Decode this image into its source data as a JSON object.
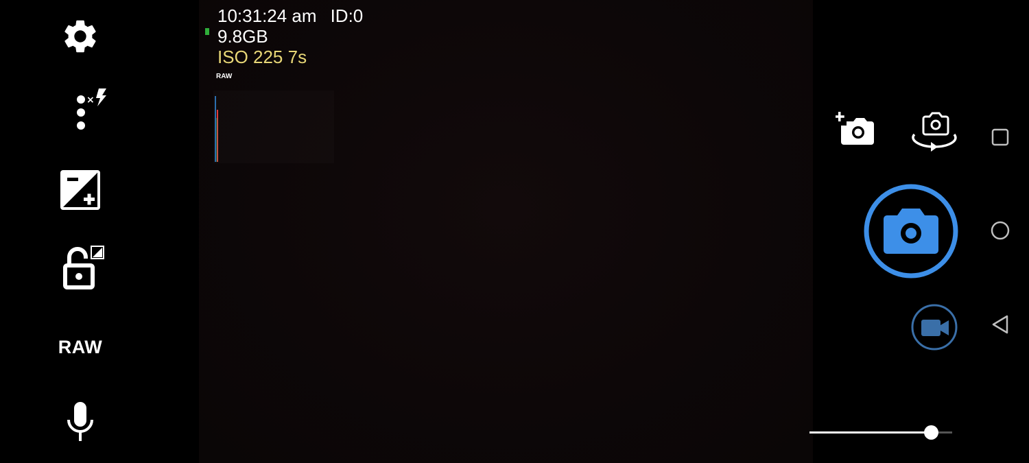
{
  "left_toolbar": {
    "settings_icon": "gear-icon",
    "flash_icon": "flash-off-icon",
    "exposure_icon": "exposure-compensation-icon",
    "exposure_lock_icon": "exposure-lock-icon",
    "raw_label": "RAW",
    "mic_icon": "microphone-icon"
  },
  "overlay": {
    "time": "10:31:24 am",
    "camera_id": "ID:0",
    "free_storage": "9.8GB",
    "iso_exposure": "ISO 225 7s",
    "raw_indicator": "RAW",
    "battery_color": "#2fae3a",
    "iso_color": "#e8d777"
  },
  "right_toolbar": {
    "switch_multi_camera_icon": "add-camera-icon",
    "switch_camera_icon": "flip-camera-icon",
    "shutter_icon": "camera-icon",
    "video_icon": "video-camera-icon",
    "accent_color": "#3d8fe8",
    "zoom_level": 0.85
  },
  "system_nav": {
    "recents_icon": "square-icon",
    "home_icon": "circle-icon",
    "back_icon": "back-triangle-icon"
  }
}
